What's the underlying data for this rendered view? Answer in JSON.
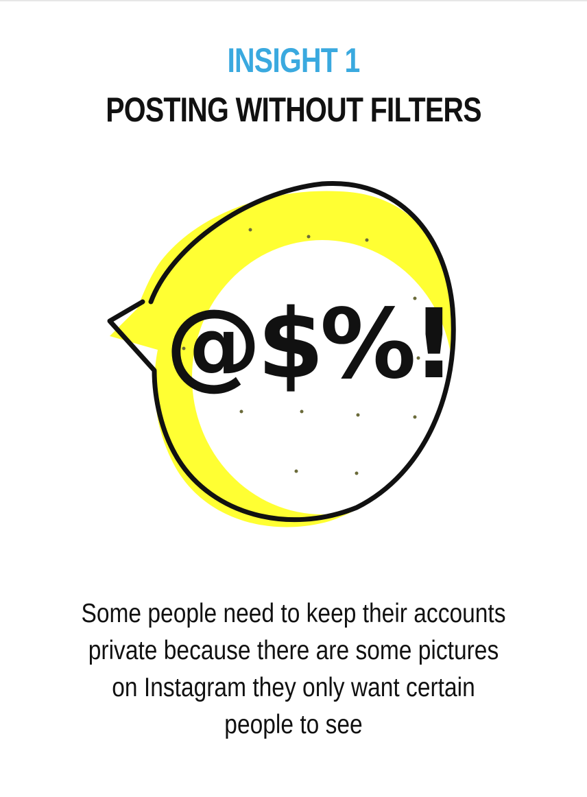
{
  "header": {
    "insight_label": "INSIGHT 1",
    "title": "POSTING WITHOUT FILTERS"
  },
  "illustration": {
    "symbols_text": "@$%!",
    "bubble_fill_color": "#ffff33",
    "outline_color": "#111111"
  },
  "body": {
    "description": "Some people need to keep their accounts private because there are some pictures on Instagram they only want certain people to see"
  },
  "colors": {
    "accent": "#3aa9df",
    "text": "#111111",
    "background": "#ffffff"
  }
}
